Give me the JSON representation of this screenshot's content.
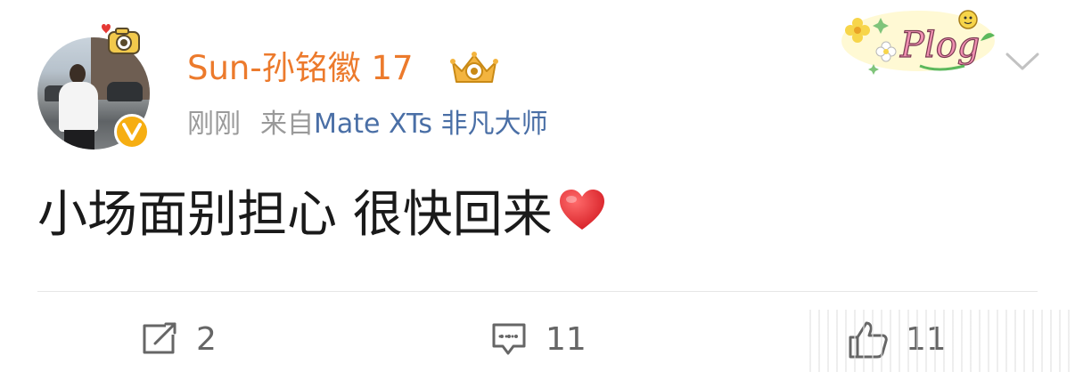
{
  "post": {
    "author": {
      "name": "Sun-孙铭徽 17",
      "verified": true,
      "verified_badge_color": "#f6ae12",
      "name_color": "#ec7a2c",
      "avatar_icon": "profile-photo",
      "member_icon": "crown-icon"
    },
    "meta": {
      "time": "刚刚",
      "source_prefix": "来自",
      "device": "Mate XTs 非凡大师",
      "device_color": "#4a6fa6"
    },
    "decoration": "plog-sticker",
    "text": "小场面别担心 很快回来",
    "emoji": "red-heart",
    "actions": {
      "repost": {
        "icon": "share-icon",
        "count": "2"
      },
      "comment": {
        "icon": "comment-icon",
        "count": "11"
      },
      "like": {
        "icon": "thumbs-up-icon",
        "count": "11"
      }
    }
  }
}
